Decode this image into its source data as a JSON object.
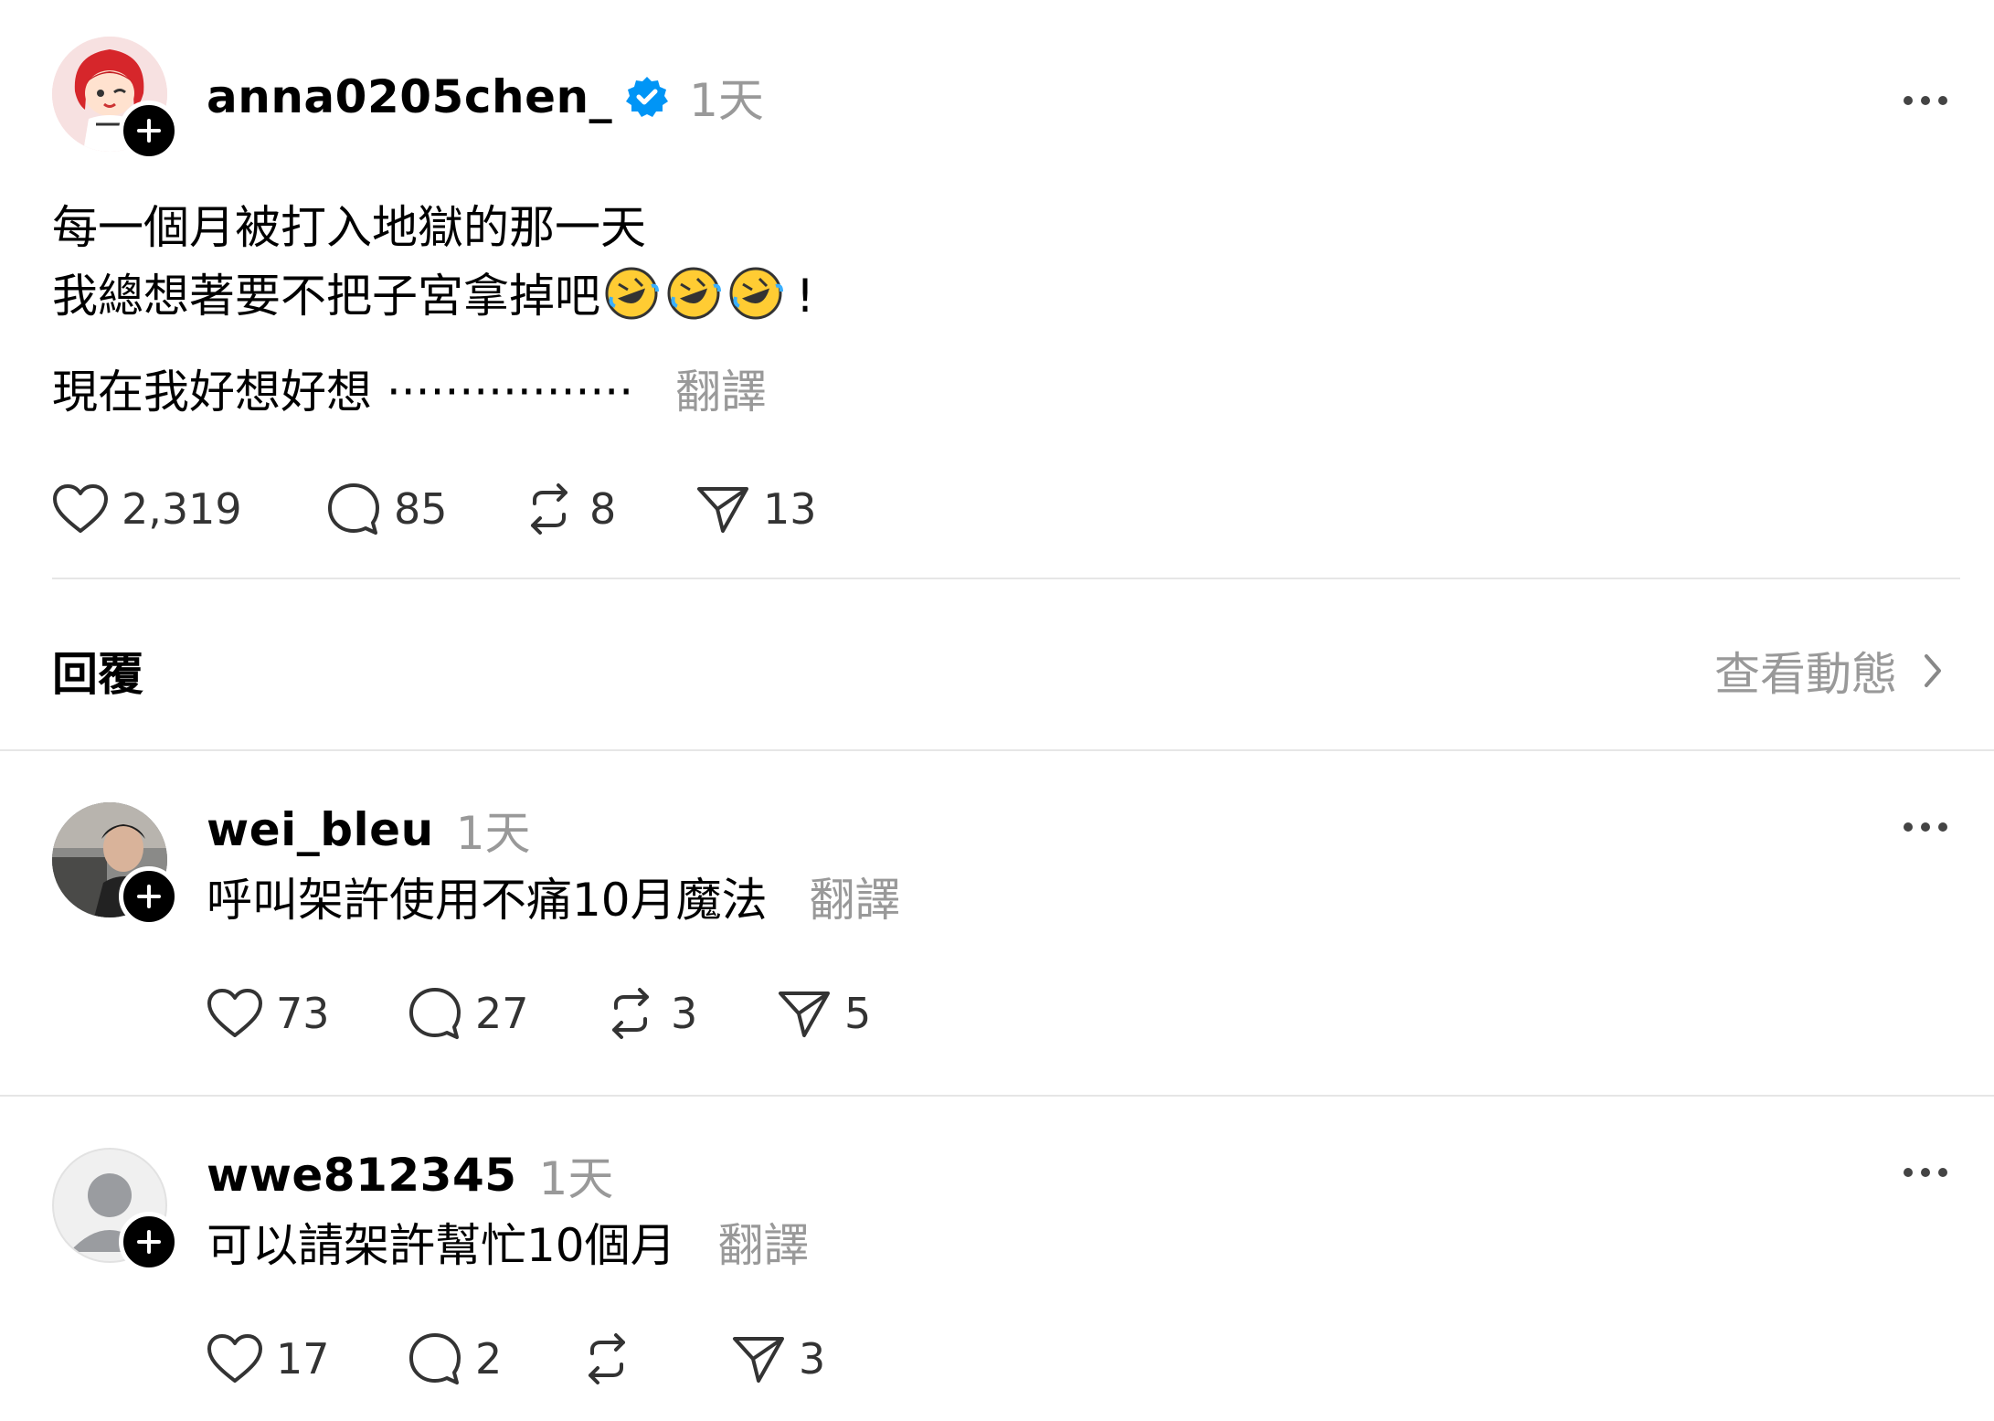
{
  "post": {
    "username": "anna0205chen_",
    "time": "1天",
    "line1": "每一個月被打入地獄的那一天",
    "line2": "我總想著要不把子宮拿掉吧",
    "line2_end": "!",
    "line3": "現在我好想好想 ·················",
    "translate": "翻譯",
    "likes": "2,319",
    "comments": "85",
    "reposts": "8",
    "shares": "13",
    "accent": "#0095f6"
  },
  "replies_header": {
    "title": "回覆",
    "view_activity": "查看動態"
  },
  "replies": [
    {
      "username": "wei_bleu",
      "time": "1天",
      "text": "呼叫架許使用不痛10月魔法",
      "translate": "翻譯",
      "likes": "73",
      "comments": "27",
      "reposts": "3",
      "shares": "5"
    },
    {
      "username": "wwe812345",
      "time": "1天",
      "text": "可以請架許幫忙10個月",
      "translate": "翻譯",
      "likes": "17",
      "comments": "2",
      "reposts": "",
      "shares": "3"
    }
  ]
}
